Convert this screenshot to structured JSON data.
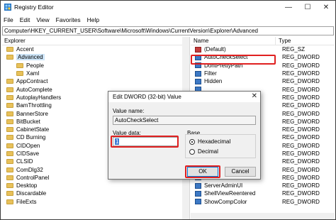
{
  "window": {
    "title": "Registry Editor",
    "controls": {
      "minimize": "—",
      "maximize": "☐",
      "close": "✕"
    }
  },
  "menu": [
    "File",
    "Edit",
    "View",
    "Favorites",
    "Help"
  ],
  "address": "Computer\\HKEY_CURRENT_USER\\Software\\Microsoft\\Windows\\CurrentVersion\\Explorer\\Advanced",
  "tree": {
    "header": "Explorer",
    "items": [
      {
        "label": "Accent",
        "indent": 1
      },
      {
        "label": "Advanced",
        "indent": 1,
        "selected": true
      },
      {
        "label": "People",
        "indent": 2
      },
      {
        "label": "Xaml",
        "indent": 2
      },
      {
        "label": "AppContract",
        "indent": 1
      },
      {
        "label": "AutoComplete",
        "indent": 1
      },
      {
        "label": "AutoplayHandlers",
        "indent": 1
      },
      {
        "label": "BamThrottling",
        "indent": 1
      },
      {
        "label": "BannerStore",
        "indent": 1
      },
      {
        "label": "BitBucket",
        "indent": 1
      },
      {
        "label": "CabinetState",
        "indent": 1
      },
      {
        "label": "CD Burning",
        "indent": 1
      },
      {
        "label": "CIDOpen",
        "indent": 1
      },
      {
        "label": "CIDSave",
        "indent": 1
      },
      {
        "label": "CLSID",
        "indent": 1
      },
      {
        "label": "ComDlg32",
        "indent": 1
      },
      {
        "label": "ControlPanel",
        "indent": 1
      },
      {
        "label": "Desktop",
        "indent": 1
      },
      {
        "label": "Discardable",
        "indent": 1
      },
      {
        "label": "FileExts",
        "indent": 1
      }
    ]
  },
  "values": {
    "header_name": "Name",
    "header_type": "Type",
    "rows": [
      {
        "name": "(Default)",
        "type": "REG_SZ",
        "kind": "sz"
      },
      {
        "name": "AutoCheckSelect",
        "type": "REG_DWORD",
        "kind": "dword"
      },
      {
        "name": "DontPrettyPath",
        "type": "REG_DWORD",
        "kind": "dword"
      },
      {
        "name": "Filter",
        "type": "REG_DWORD",
        "kind": "dword"
      },
      {
        "name": "Hidden",
        "type": "REG_DWORD",
        "kind": "dword"
      },
      {
        "name": "",
        "type": "REG_DWORD",
        "kind": "dword"
      },
      {
        "name": "",
        "type": "REG_DWORD",
        "kind": "dword"
      },
      {
        "name": "",
        "type": "REG_DWORD",
        "kind": "dword"
      },
      {
        "name": "",
        "type": "REG_DWORD",
        "kind": "dword"
      },
      {
        "name": "",
        "type": "REG_DWORD",
        "kind": "dword"
      },
      {
        "name": "",
        "type": "REG_DWORD",
        "kind": "dword"
      },
      {
        "name": "",
        "type": "REG_DWORD",
        "kind": "dword"
      },
      {
        "name": "",
        "type": "REG_DWORD",
        "kind": "dword"
      },
      {
        "name": "",
        "type": "REG_DWORD",
        "kind": "dword"
      },
      {
        "name": "",
        "type": "REG_DWORD",
        "kind": "dword"
      },
      {
        "name": "",
        "type": "REG_DWORD",
        "kind": "dword"
      },
      {
        "name": "",
        "type": "REG_DWORD",
        "kind": "dword"
      },
      {
        "name": "ServerAdminUI",
        "type": "REG_DWORD",
        "kind": "dword"
      },
      {
        "name": "ShellViewReentered",
        "type": "REG_DWORD",
        "kind": "dword"
      },
      {
        "name": "ShowCompColor",
        "type": "REG_DWORD",
        "kind": "dword"
      }
    ]
  },
  "dialog": {
    "title": "Edit DWORD (32-bit) Value",
    "close": "✕",
    "value_name_label": "Value name:",
    "value_name": "AutoCheckSelect",
    "value_data_label": "Value data:",
    "value_data": "1",
    "base_label": "Base",
    "hex_label": "Hexadecimal",
    "dec_label": "Decimal",
    "base_selected": "Hexadecimal",
    "ok_label": "OK",
    "cancel_label": "Cancel"
  },
  "colors": {
    "highlight": "#e02020",
    "selection": "#cce4f7",
    "folder": "#e8c15a",
    "dword_icon": "#3c78c4"
  }
}
